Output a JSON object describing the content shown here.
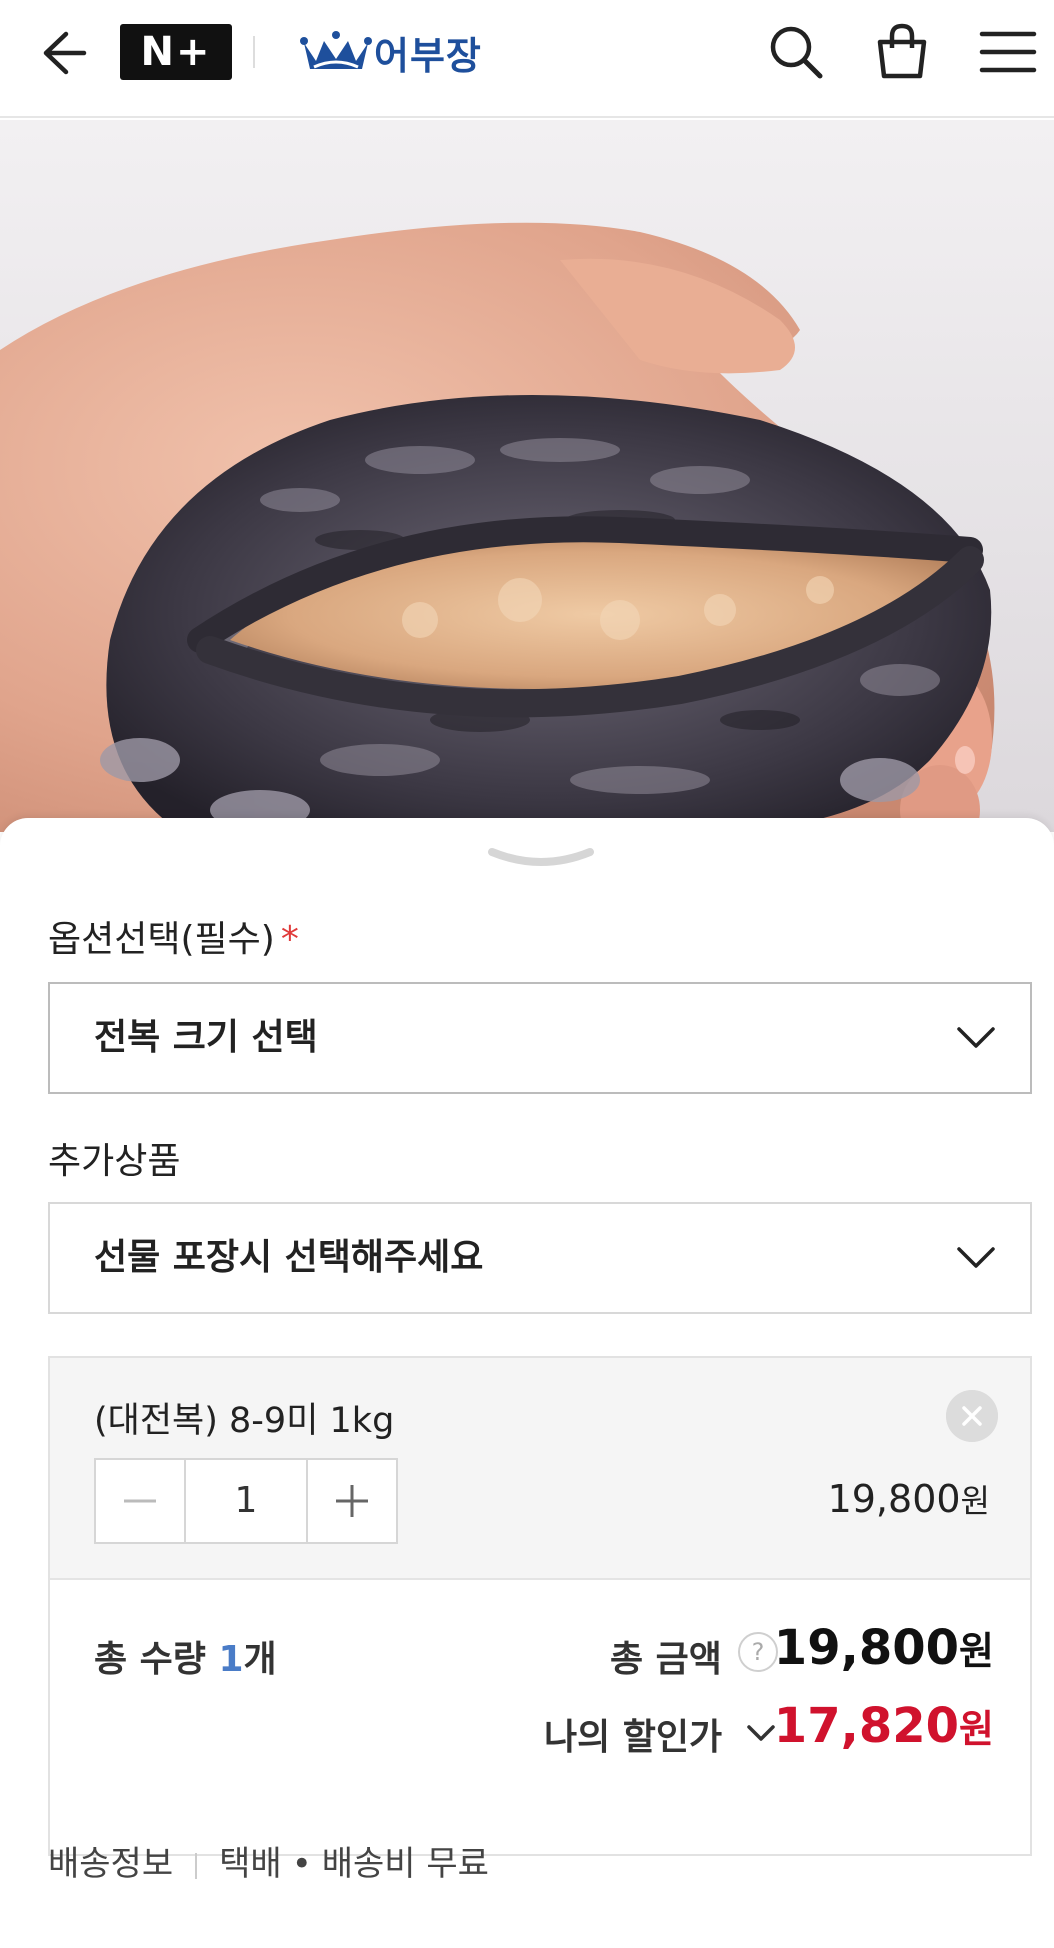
{
  "header": {
    "nplus_label": "N+",
    "brand_name": "어부장",
    "brand_color": "#1e4f9c"
  },
  "hero": {
    "alt": "abalone-in-hand-photo"
  },
  "options": {
    "required_label": "옵션선택(필수)",
    "required_mark": "*",
    "size_select_text": "전복 크기 선택",
    "addon_label": "추가상품",
    "addon_select_text": "선물 포장시 선택해주세요"
  },
  "selected_item": {
    "name": "(대전복) 8-9미 1kg",
    "quantity": "1",
    "price": "19,800",
    "price_unit": "원"
  },
  "summary": {
    "qty_prefix": "총 수량 ",
    "qty_value": "1",
    "qty_suffix": "개",
    "total_label": "총 금액",
    "help_mark": "?",
    "total_value": "19,800",
    "total_unit": "원",
    "discount_label": "나의 할인가",
    "discount_value": "17,820",
    "discount_unit": "원",
    "discount_color": "#d0122d"
  },
  "shipping": {
    "label": "배송정보",
    "method": "택배",
    "fee": "배송비 무료"
  }
}
